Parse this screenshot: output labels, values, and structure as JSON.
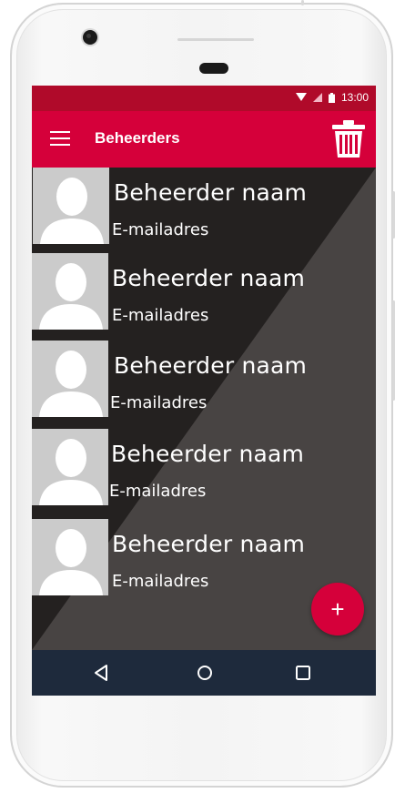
{
  "status_bar": {
    "time": "13:00",
    "icons": [
      "wifi-icon",
      "signal-icon",
      "battery-icon"
    ]
  },
  "app_bar": {
    "title": "Beheerders",
    "menu_icon": "menu-icon",
    "delete_icon": "trash-icon"
  },
  "items": [
    {
      "name": "Beheerder naam",
      "email": "E-mailadres"
    },
    {
      "name": "Beheerder naam",
      "email": "E-mailadres"
    },
    {
      "name": "Beheerder naam",
      "email": "E-mailadres"
    },
    {
      "name": "Beheerder naam",
      "email": "E-mailadres"
    },
    {
      "name": "Beheerder naam",
      "email": "E-mailadres"
    }
  ],
  "fab": {
    "label": "+"
  },
  "nav_bar": {
    "icons": [
      "back-icon",
      "home-icon",
      "recents-icon"
    ]
  },
  "colors": {
    "primary": "#d5003a",
    "status_bar": "#b00a2a",
    "nav_bar": "#1e2a3c",
    "background_dark": "#252221",
    "background_light": "#484443"
  }
}
